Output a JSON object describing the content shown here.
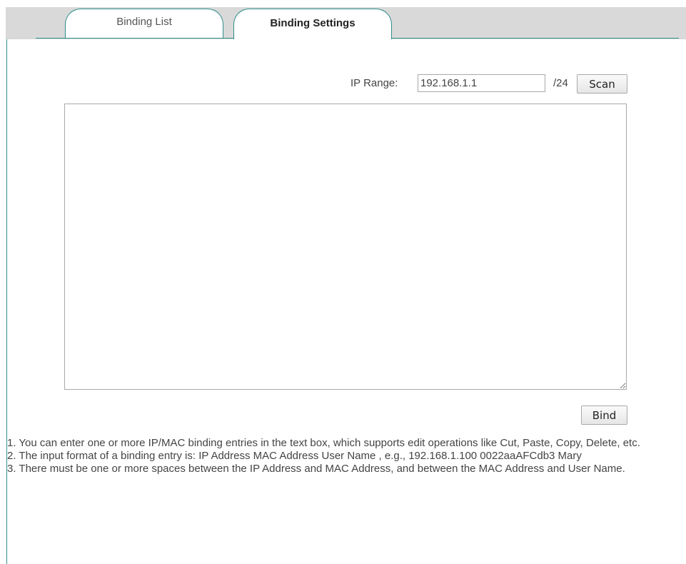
{
  "tabs": {
    "binding_list": "Binding List",
    "binding_settings": "Binding Settings"
  },
  "ip_range": {
    "label": "IP Range:",
    "value": "192.168.1.1",
    "suffix": "/24",
    "scan_label": "Scan"
  },
  "binding_entries": {
    "value": ""
  },
  "bind_label": "Bind",
  "notes": [
    "1. You can enter one or more IP/MAC binding entries in the text box, which supports edit operations like Cut, Paste, Copy, Delete, etc.",
    "2. The input format of a binding entry is: IP Address MAC Address User Name , e.g., 192.168.1.100 0022aaAFCdb3 Mary",
    "3. There must be one or more spaces between the IP Address and MAC Address, and between the MAC Address and User Name."
  ]
}
